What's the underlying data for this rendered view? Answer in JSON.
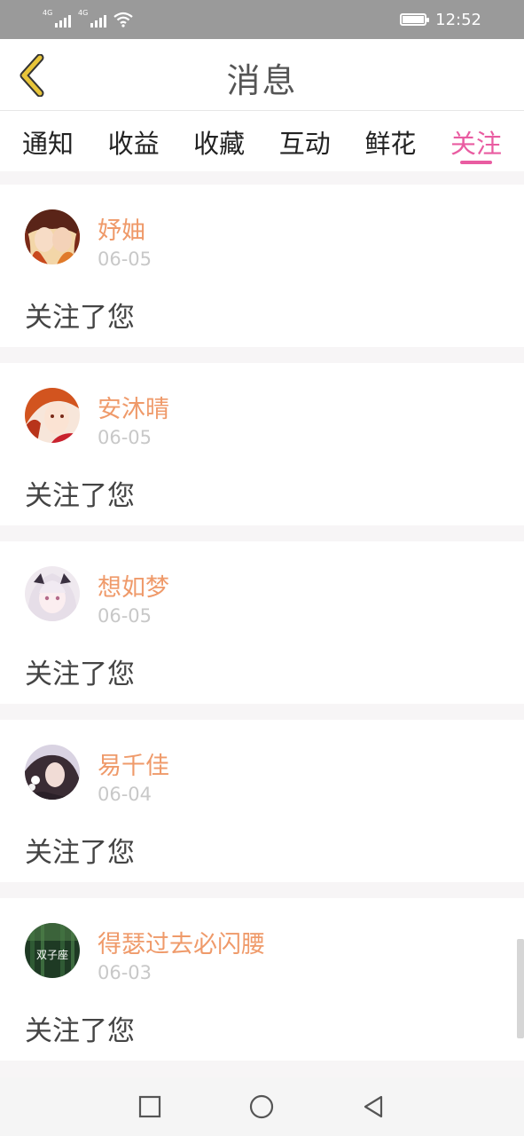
{
  "status_bar": {
    "network_1": "4G",
    "network_2": "4G",
    "time": "12:52"
  },
  "header": {
    "title": "消息",
    "back_icon": "chevron-left-icon"
  },
  "tabs": [
    {
      "label": "通知",
      "active": false
    },
    {
      "label": "收益",
      "active": false
    },
    {
      "label": "收藏",
      "active": false
    },
    {
      "label": "互动",
      "active": false
    },
    {
      "label": "鲜花",
      "active": false
    },
    {
      "label": "关注",
      "active": true
    }
  ],
  "messages": [
    {
      "name": "妤妯",
      "date": "06-05",
      "text": "关注了您"
    },
    {
      "name": "安沐晴",
      "date": "06-05",
      "text": "关注了您"
    },
    {
      "name": "想如梦",
      "date": "06-05",
      "text": "关注了您"
    },
    {
      "name": "易千佳",
      "date": "06-04",
      "text": "关注了您"
    },
    {
      "name": "得瑟过去必闪腰",
      "date": "06-03",
      "text": "关注了您",
      "avatar_text": "双子座"
    }
  ],
  "colors": {
    "accent": "#e95ca1",
    "username": "#ef9a6a",
    "back_arrow": "#e8c53a"
  },
  "nav_bar": {
    "recent_icon": "square-icon",
    "home_icon": "circle-icon",
    "back_icon": "triangle-back-icon"
  }
}
